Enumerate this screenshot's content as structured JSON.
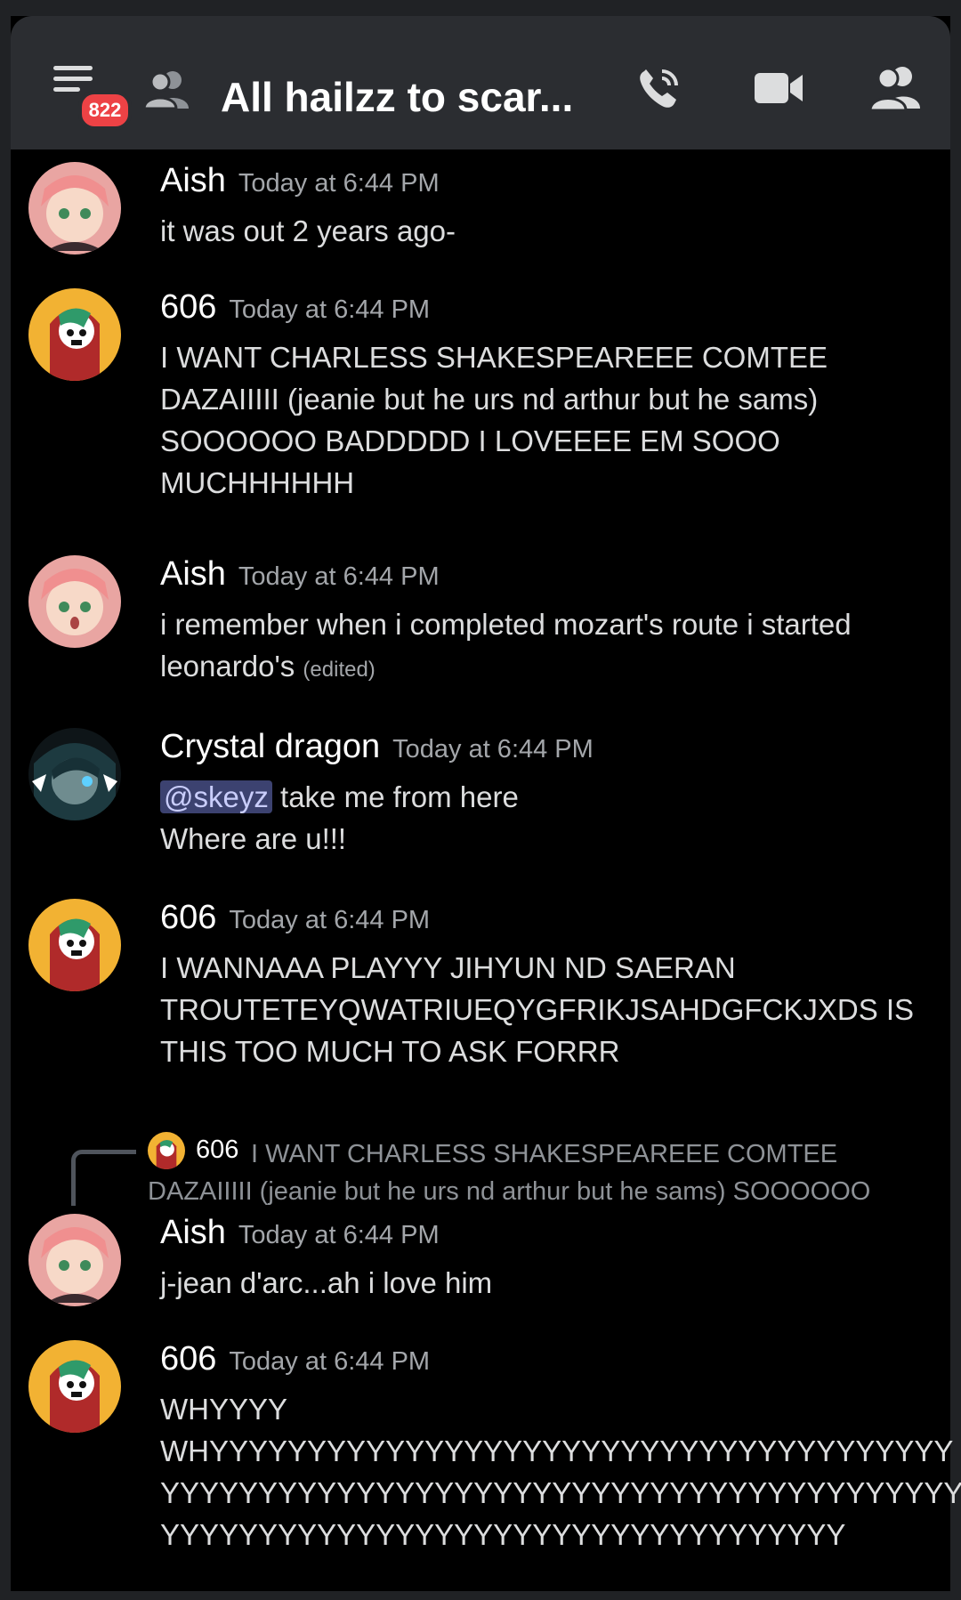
{
  "header": {
    "notification_count": "822",
    "title": "All hailzz to scar..."
  },
  "messages": [
    {
      "author": "Aish",
      "time": "Today at 6:44 PM",
      "lines": [
        "it was out 2 years ago-"
      ]
    },
    {
      "author": "606",
      "time": "Today at 6:44 PM",
      "lines": [
        "I WANT CHARLESS SHAKESPEAREEE COMTEE",
        "DAZAIIIII (jeanie but he urs nd arthur but he sams)",
        "SOOOOOO BADDDDD I LOVEEEE EM SOOO",
        "MUCHHHHHH"
      ]
    },
    {
      "author": "Aish",
      "time": "Today at 6:44 PM",
      "lines": [
        "i remember when i completed mozart's route i started",
        "leonardo's"
      ],
      "edited": "(edited)"
    },
    {
      "author": "Crystal dragon",
      "time": "Today at 6:44 PM",
      "mention": "@skeyz",
      "lines": [
        "take me from here",
        "Where are u!!!"
      ]
    },
    {
      "author": "606",
      "time": "Today at 6:44 PM",
      "lines": [
        "I WANNAAA PLAYYY JIHYUN ND SAERAN",
        "TROUTETEYQWATRIUEQYGFRIKJSAHDGFCKJXDS IS",
        "THIS TOO MUCH TO ASK FORRR"
      ]
    },
    {
      "author": "Aish",
      "time": "Today at 6:44 PM",
      "lines": [
        "j-jean d'arc...ah i love him"
      ]
    },
    {
      "author": "606",
      "time": "Today at 6:44 PM",
      "lines": [
        "WHYYYY",
        "WHYYYYYYYYYYYYYYYYYYYYYYYYYYYYYYYYYYYYYY",
        "YYYYYYYYYYYYYYYYYYYYYYYYYYYYYYYYYYYYYYYYY",
        "YYYYYYYYYYYYYYYYYYYYYYYYYYYYYYYYYYY"
      ]
    }
  ],
  "reply": {
    "author": "606",
    "text_line1": "I WANT CHARLESS SHAKESPEAREEE COMTEE",
    "text_line2": "DAZAIIIII (jeanie but he urs nd arthur but he sams) SOOOOOO"
  },
  "icons": {
    "menu": "hamburger-menu-icon",
    "group": "group-dm-icon",
    "call": "phone-call-icon",
    "video": "video-camera-icon",
    "members": "member-list-icon"
  },
  "colors": {
    "background": "#000000",
    "header": "#2b2d31",
    "badge": "#ed4245",
    "mention": "#3c4270"
  }
}
